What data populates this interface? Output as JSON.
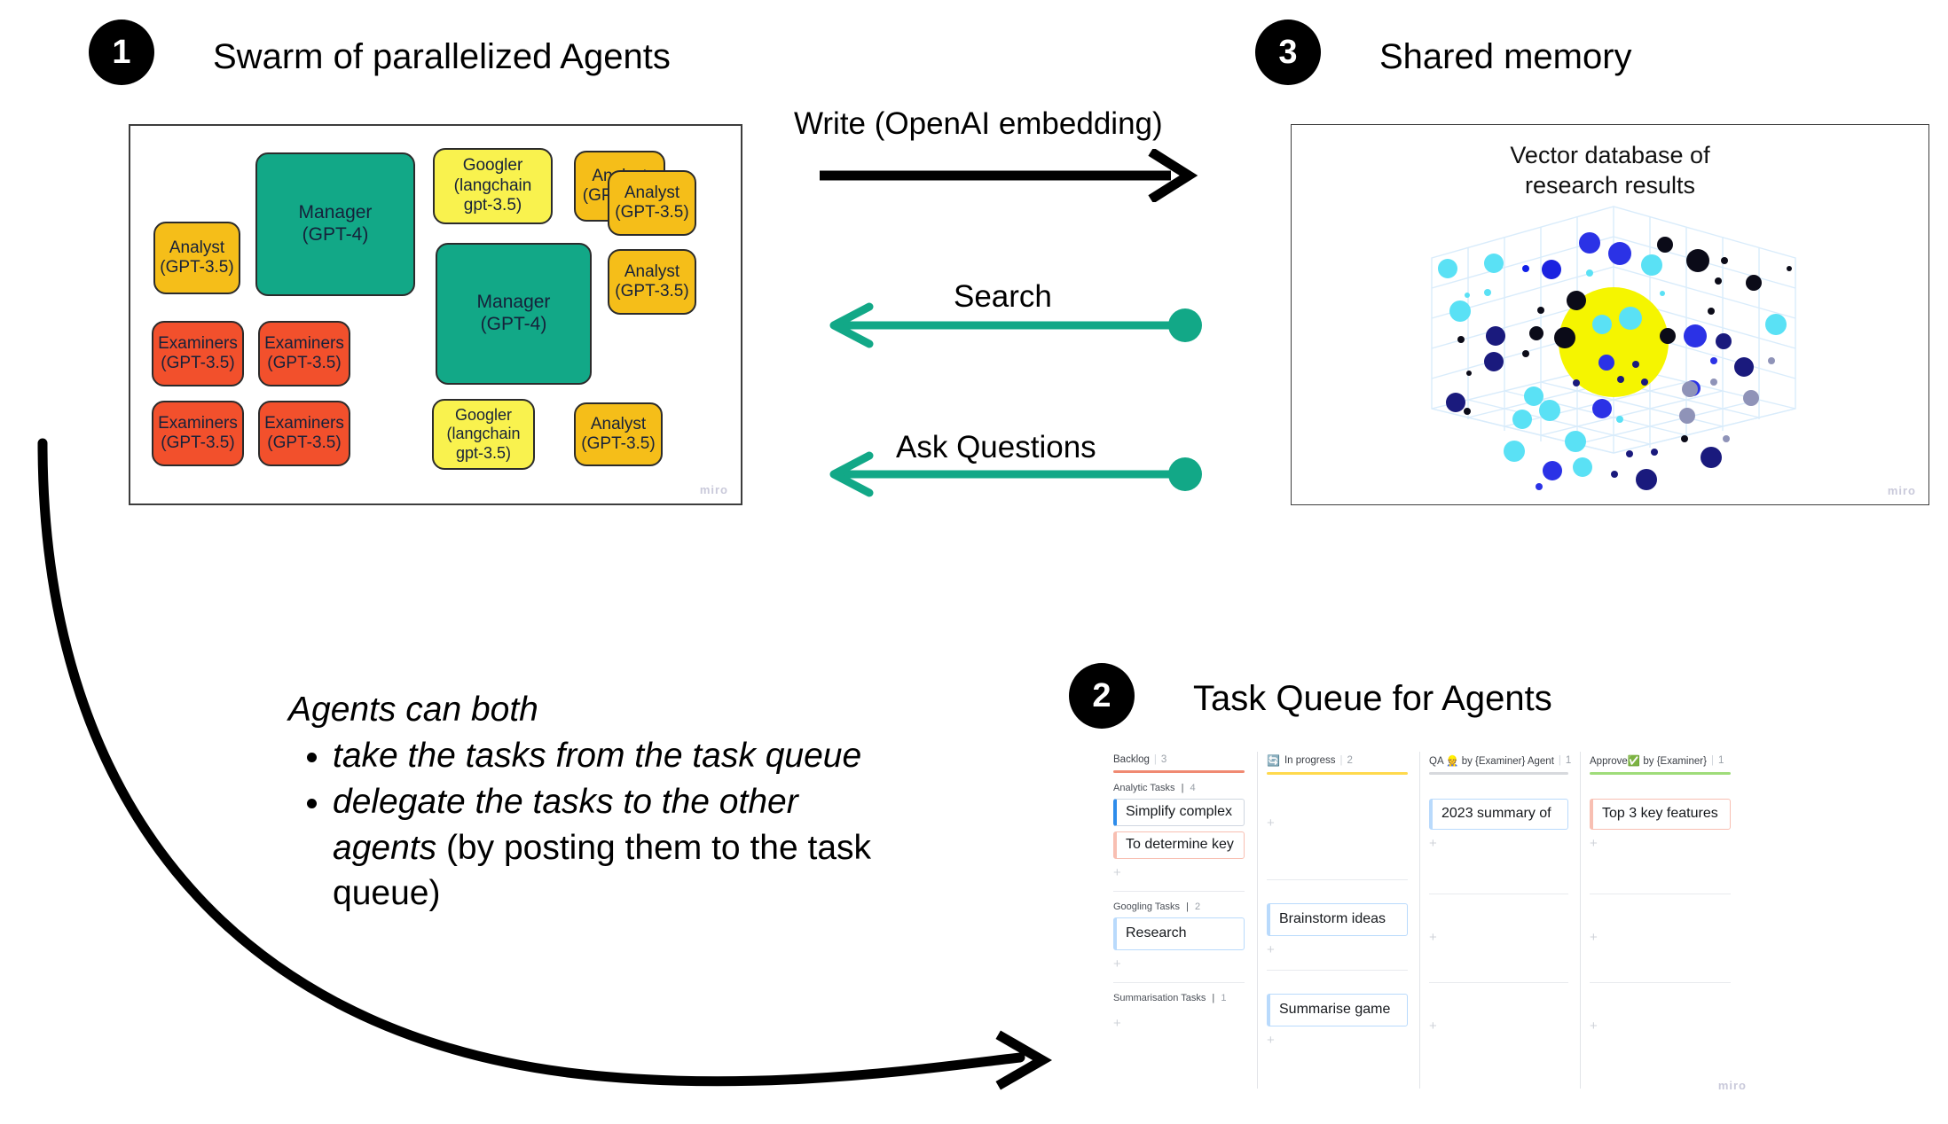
{
  "sections": {
    "swarm": {
      "number": "1",
      "title": "Swarm of parallelized Agents",
      "watermark": "miro"
    },
    "queue": {
      "number": "2",
      "title": "Task Queue for Agents",
      "watermark": "miro"
    },
    "memory": {
      "number": "3",
      "title": "Shared memory",
      "watermark": "miro"
    }
  },
  "swarm": {
    "agents": [
      {
        "role": "Analyst",
        "model": "(GPT-3.5)",
        "color": "amber"
      },
      {
        "role": "Manager",
        "model": "(GPT-4)",
        "color": "teal"
      },
      {
        "role": "Googler",
        "model": "(langchain",
        "model2": "gpt-3.5)",
        "color": "yellow"
      },
      {
        "role": "Analyst",
        "model": "(GPT-3.5)",
        "color": "amber"
      },
      {
        "role": "Manager",
        "model": "(GPT-4)",
        "color": "teal"
      },
      {
        "role": "Analyst",
        "model": "(GPT-3.5)",
        "color": "amber"
      },
      {
        "role": "Analyst",
        "model": "(GPT-3.5)",
        "color": "amber"
      },
      {
        "role": "Examiners",
        "model": "(GPT-3.5)",
        "color": "red"
      },
      {
        "role": "Examiners",
        "model": "(GPT-3.5)",
        "color": "red"
      },
      {
        "role": "Examiners",
        "model": "(GPT-3.5)",
        "color": "red"
      },
      {
        "role": "Examiners",
        "model": "(GPT-3.5)",
        "color": "red"
      },
      {
        "role": "Googler",
        "model": "(langchain",
        "model2": "gpt-3.5)",
        "color": "yellow"
      },
      {
        "role": "Analyst",
        "model": "(GPT-3.5)",
        "color": "amber"
      }
    ],
    "colors": {
      "teal": "#12a887",
      "amber": "#f5be19",
      "yellow": "#f9f24e",
      "red": "#f2502c"
    }
  },
  "arrows": [
    {
      "label": "Write (OpenAI embedding)",
      "direction": "right",
      "color": "#000000"
    },
    {
      "label": "Search",
      "direction": "left",
      "color": "#12a887"
    },
    {
      "label": "Ask Questions",
      "direction": "left",
      "color": "#12a887"
    }
  ],
  "memory": {
    "caption_line1": "Vector database of",
    "caption_line2": "research results",
    "highlight_color": "#f5f500"
  },
  "note": {
    "intro": "Agents can both",
    "bullet1": "take the tasks from the task queue",
    "bullet2_italic": "delegate the tasks to the other agents ",
    "bullet2_plain": "(by posting them to the task queue)"
  },
  "kanban": {
    "columns": [
      {
        "title": "Backlog",
        "icon": "",
        "count": "3",
        "rule_color": "#f08a72",
        "groups": [
          {
            "title": "Analytic Tasks",
            "count": "4",
            "cards": [
              {
                "text": "Simplify complex",
                "style": "blue"
              },
              {
                "text": "To determine key",
                "style": "red"
              }
            ],
            "add": "+"
          },
          {
            "title": "Googling Tasks",
            "count": "2",
            "cards": [
              {
                "text": "Research",
                "style": "lblue"
              }
            ],
            "add": "+"
          },
          {
            "title": "Summarisation Tasks",
            "count": "1",
            "cards": [],
            "add": "+"
          }
        ]
      },
      {
        "title": "In progress",
        "icon": "🔄",
        "count": "2",
        "rule_color": "#ffd94d",
        "groups": [
          {
            "title": "",
            "count": "",
            "cards": [],
            "add": "+"
          },
          {
            "title": "",
            "count": "",
            "cards": [
              {
                "text": "Brainstorm ideas",
                "style": "lblue"
              }
            ],
            "add": "+"
          },
          {
            "title": "",
            "count": "",
            "cards": [
              {
                "text": "Summarise game",
                "style": "lblue"
              }
            ],
            "add": "+"
          }
        ]
      },
      {
        "title": "QA 👷 by {Examiner} Agent",
        "icon": "",
        "count": "1",
        "rule_color": "#d7d9dd",
        "groups": [
          {
            "title": "",
            "count": "",
            "cards": [
              {
                "text": "2023 summary of",
                "style": "lblue"
              }
            ],
            "add": "+"
          },
          {
            "title": "",
            "count": "",
            "cards": [],
            "add": "+"
          },
          {
            "title": "",
            "count": "",
            "cards": [],
            "add": "+"
          }
        ]
      },
      {
        "title": "Approve✅ by {Examiner}",
        "icon": "",
        "count": "1",
        "rule_color": "#9fdc7a",
        "groups": [
          {
            "title": "",
            "count": "",
            "cards": [
              {
                "text": "Top 3 key features",
                "style": "red"
              }
            ],
            "add": "+"
          },
          {
            "title": "",
            "count": "",
            "cards": [],
            "add": "+"
          },
          {
            "title": "",
            "count": "",
            "cards": [],
            "add": "+"
          }
        ]
      }
    ]
  }
}
